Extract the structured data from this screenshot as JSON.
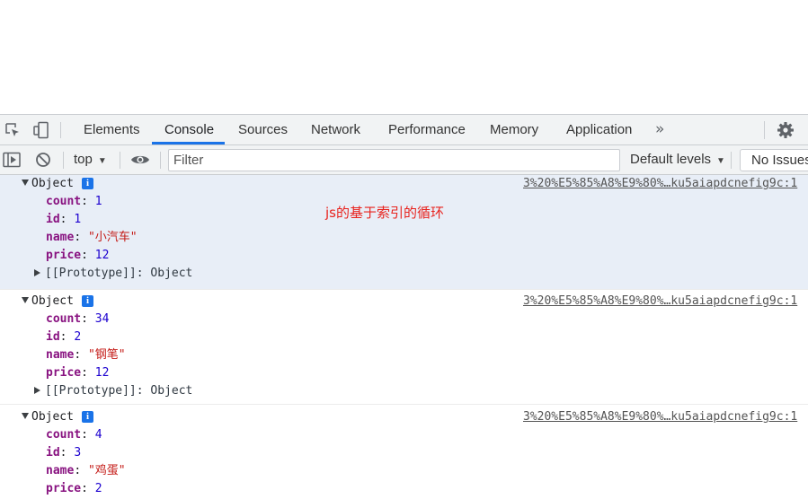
{
  "devtools": {
    "tabs": [
      {
        "label": "Elements"
      },
      {
        "label": "Console",
        "active": true
      },
      {
        "label": "Sources"
      },
      {
        "label": "Network"
      },
      {
        "label": "Performance"
      },
      {
        "label": "Memory"
      },
      {
        "label": "Application"
      }
    ],
    "more_tabs_icon": "»",
    "accent_color": "#1a73e8"
  },
  "console_toolbar": {
    "context": "top",
    "filter_placeholder": "Filter",
    "levels": "Default levels",
    "issues": "No Issues"
  },
  "annotation": "js的基于索引的循环",
  "messages": [
    {
      "label": "Object",
      "source": "3%20%E5%85%A8%E9%80%…ku5aiapdcnefig9c:1",
      "props": [
        {
          "key": "count",
          "value": "1",
          "type": "number"
        },
        {
          "key": "id",
          "value": "1",
          "type": "number"
        },
        {
          "key": "name",
          "value": "\"小汽车\"",
          "type": "string"
        },
        {
          "key": "price",
          "value": "12",
          "type": "number"
        }
      ],
      "prototype": "[[Prototype]]: Object"
    },
    {
      "label": "Object",
      "source": "3%20%E5%85%A8%E9%80%…ku5aiapdcnefig9c:1",
      "props": [
        {
          "key": "count",
          "value": "34",
          "type": "number"
        },
        {
          "key": "id",
          "value": "2",
          "type": "number"
        },
        {
          "key": "name",
          "value": "\"钢笔\"",
          "type": "string"
        },
        {
          "key": "price",
          "value": "12",
          "type": "number"
        }
      ],
      "prototype": "[[Prototype]]: Object"
    },
    {
      "label": "Object",
      "source": "3%20%E5%85%A8%E9%80%…ku5aiapdcnefig9c:1",
      "props": [
        {
          "key": "count",
          "value": "4",
          "type": "number"
        },
        {
          "key": "id",
          "value": "3",
          "type": "number"
        },
        {
          "key": "name",
          "value": "\"鸡蛋\"",
          "type": "string"
        },
        {
          "key": "price",
          "value": "2",
          "type": "number"
        }
      ]
    }
  ]
}
